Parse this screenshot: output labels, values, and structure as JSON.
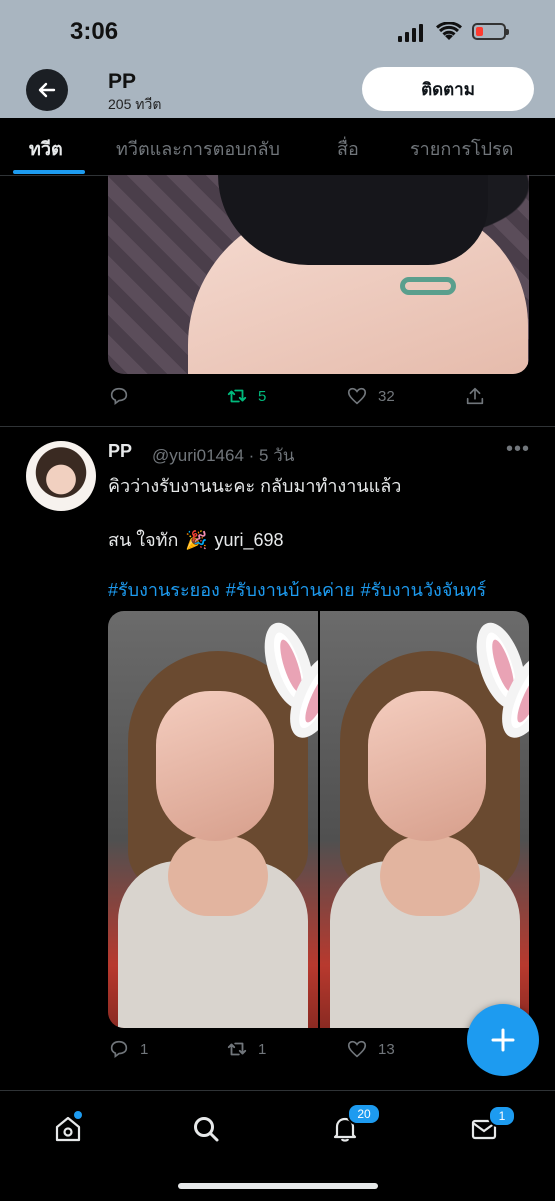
{
  "status_bar": {
    "time": "3:06"
  },
  "header": {
    "name": "PP",
    "tweet_count": "205 ทวีต",
    "follow_label": "ติดตาม"
  },
  "tabs": [
    "ทวีต",
    "ทวีตและการตอบกลับ",
    "สื่อ",
    "รายการโปรด"
  ],
  "first_tweet": {
    "retweets": "5",
    "likes": "32"
  },
  "tweet": {
    "name": "PP",
    "handle_time": "@yuri01464 · 5 วัน",
    "line1": "คิวว่างรับงานนะคะ กลับมาทำงานแล้ว",
    "line2_prefix": "สน ใจทัก",
    "line2_emoji": "🎉",
    "line2_suffix": "yuri_698",
    "hashtags": [
      "#รับงานระยอง",
      "#รับงานบ้านค่าย",
      "#รับงานวังจันทร์"
    ],
    "replies": "1",
    "retweets": "1",
    "likes": "13"
  },
  "bottom_nav": {
    "notifications_badge": "20",
    "messages_badge": "1"
  },
  "colors": {
    "accent": "#1d9bf0",
    "retweet_green": "#00ba7c",
    "muted": "#71767b"
  }
}
